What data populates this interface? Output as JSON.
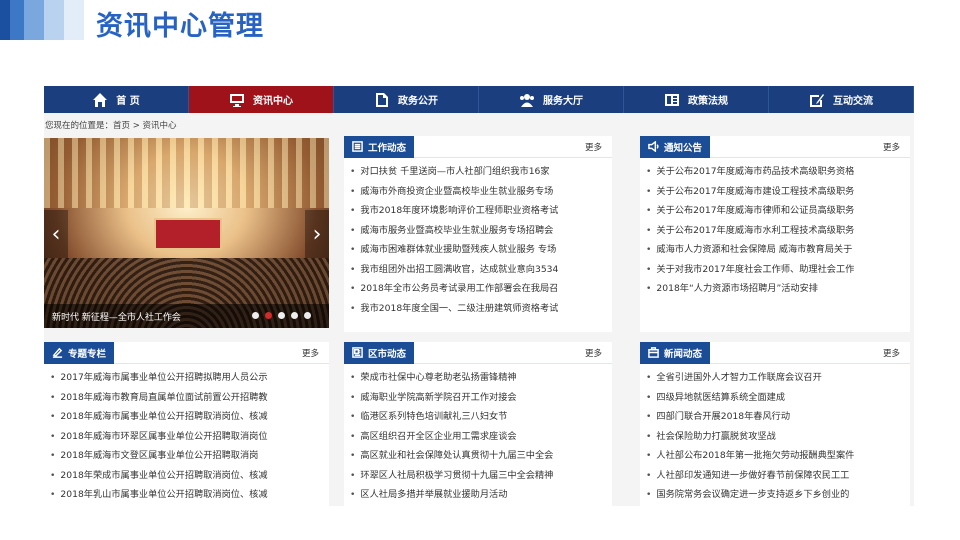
{
  "slide": {
    "title": "资讯中心管理"
  },
  "nav": [
    {
      "label": "首 页",
      "icon": "home-icon",
      "active": false
    },
    {
      "label": "资讯中心",
      "icon": "monitor-icon",
      "active": true
    },
    {
      "label": "政务公开",
      "icon": "document-icon",
      "active": false
    },
    {
      "label": "服务大厅",
      "icon": "users-icon",
      "active": false
    },
    {
      "label": "政策法规",
      "icon": "book-icon",
      "active": false
    },
    {
      "label": "互动交流",
      "icon": "edit-icon",
      "active": false
    }
  ],
  "breadcrumb": "您现在的位置是：首页 > 资讯中心",
  "slideshow": {
    "caption": "新时代 新征程—全市人社工作会",
    "dot_count": 5,
    "active_dot": 2
  },
  "colors": {
    "nav_bg": "#1b3f7e",
    "active_nav": "#a0121a",
    "tab_bg": "#1b4d96"
  },
  "panels": {
    "work": {
      "title": "工作动态",
      "more": "更多",
      "items": [
        "对口扶贫 千里送岗—市人社部门组织我市16家",
        "威海市外商投资企业暨高校毕业生就业服务专场",
        "我市2018年度环境影响评价工程师职业资格考试",
        "威海市服务业暨高校毕业生就业服务专场招聘会",
        "威海市困难群体就业援助暨残疾人就业服务 专场",
        "我市组团外出招工圆满收官，达成就业意向3534",
        "2018年全市公务员考试录用工作部署会在我局召",
        "我市2018年度全国一、二级注册建筑师资格考试"
      ]
    },
    "notice": {
      "title": "通知公告",
      "more": "更多",
      "items": [
        "关于公布2017年度威海市药品技术高级职务资格",
        "关于公布2017年度威海市建设工程技术高级职务",
        "关于公布2017年度威海市律师和公证员高级职务",
        "关于公布2017年度威海市水利工程技术高级职务",
        "威海市人力资源和社会保障局 威海市教育局关于",
        "关于对我市2017年度社会工作师、助理社会工作",
        "2018年“人力资源市场招聘月”活动安排"
      ]
    },
    "special": {
      "title": "专题专栏",
      "more": "更多",
      "items": [
        "2017年威海市属事业单位公开招聘拟聘用人员公示",
        "2018年威海市教育局直属单位面试前置公开招聘教",
        "2018年威海市属事业单位公开招聘取消岗位、核减",
        "2018年威海市环翠区属事业单位公开招聘取消岗位",
        "2018年威海市文登区属事业单位公开招聘取消岗",
        "2018年荣成市属事业单位公开招聘取消岗位、核减",
        "2018年乳山市属事业单位公开招聘取消岗位、核减"
      ]
    },
    "district": {
      "title": "区市动态",
      "more": "更多",
      "items": [
        "荣成市社保中心尊老助老弘扬雷锋精神",
        "威海职业学院高新学院召开工作对接会",
        "临港区系列特色培训献礼三八妇女节",
        "高区组织召开全区企业用工需求座谈会",
        "高区就业和社会保障处认真贯彻十九届三中全会",
        "环翠区人社局积极学习贯彻十九届三中全会精神",
        "区人社局多措并举展就业援助月活动"
      ]
    },
    "news": {
      "title": "新闻动态",
      "more": "更多",
      "items": [
        "全省引进国外人才智力工作联席会议召开",
        "四级异地就医结算系统全面建成",
        "四部门联合开展2018年春风行动",
        "社会保险助力打赢脱贫攻坚战",
        "人社部公布2018年第一批拖欠劳动报酬典型案件",
        "人社部印发通知进一步做好春节前保障农民工工",
        "国务院常务会议确定进一步支持返乡下乡创业的"
      ]
    }
  }
}
